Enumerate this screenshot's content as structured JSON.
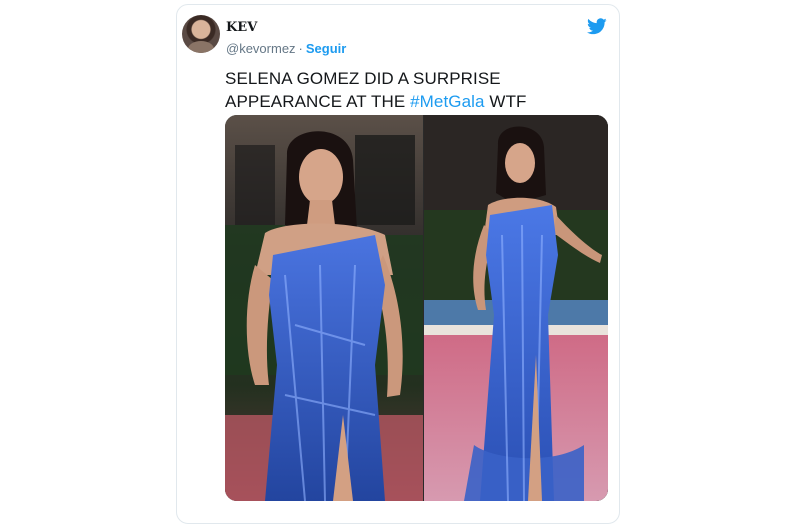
{
  "author": {
    "name": "KEV",
    "handle": "@kevormez",
    "separator": "·",
    "follow_label": "Seguir"
  },
  "tweet": {
    "text_before": "SELENA GOMEZ DID A SURPRISE APPEARANCE AT THE ",
    "hashtag": "#MetGala",
    "text_after": " WTF"
  },
  "icons": {
    "brand": "twitter-bird-icon"
  },
  "colors": {
    "accent": "#1d9bf0",
    "text": "#14171a",
    "secondary_text": "#657786",
    "gown": "#2f56c6"
  }
}
